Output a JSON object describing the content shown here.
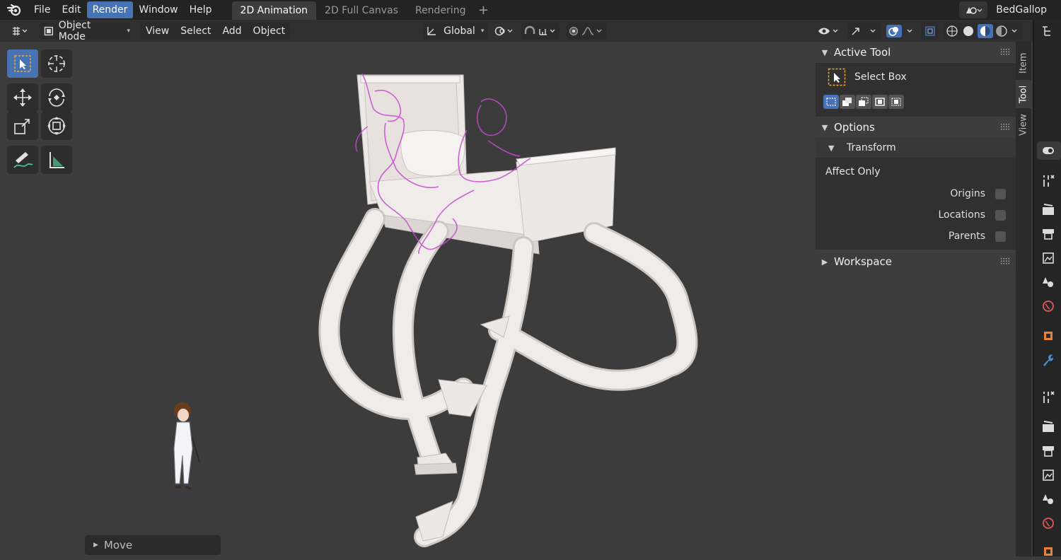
{
  "menu": {
    "items": [
      {
        "label": "File"
      },
      {
        "label": "Edit"
      },
      {
        "label": "Render",
        "active": true
      },
      {
        "label": "Window"
      },
      {
        "label": "Help"
      }
    ]
  },
  "workspaces": {
    "tabs": [
      {
        "label": "2D Animation",
        "active": true
      },
      {
        "label": "2D Full Canvas"
      },
      {
        "label": "Rendering"
      }
    ],
    "add_symbol": "+"
  },
  "user": {
    "name": "BedGallop"
  },
  "header": {
    "mode": "Object Mode",
    "menus": [
      "View",
      "Select",
      "Add",
      "Object"
    ],
    "orientation": "Global"
  },
  "npanel": {
    "active_tool": {
      "title": "Active Tool",
      "tool_name": "Select Box"
    },
    "options": {
      "title": "Options",
      "transform_title": "Transform",
      "affect_only_label": "Affect Only",
      "checkboxes": [
        {
          "label": "Origins",
          "checked": false
        },
        {
          "label": "Locations",
          "checked": false
        },
        {
          "label": "Parents",
          "checked": false
        }
      ]
    },
    "workspace": {
      "title": "Workspace"
    }
  },
  "sidebar_tabs": [
    "Item",
    "Tool",
    "View"
  ],
  "last_operator": {
    "label": "Move"
  },
  "colors": {
    "accent": "#4772b3",
    "viewport": "#3c3c3c",
    "model": "#ece8e6",
    "sketch": "#c64ad0"
  }
}
